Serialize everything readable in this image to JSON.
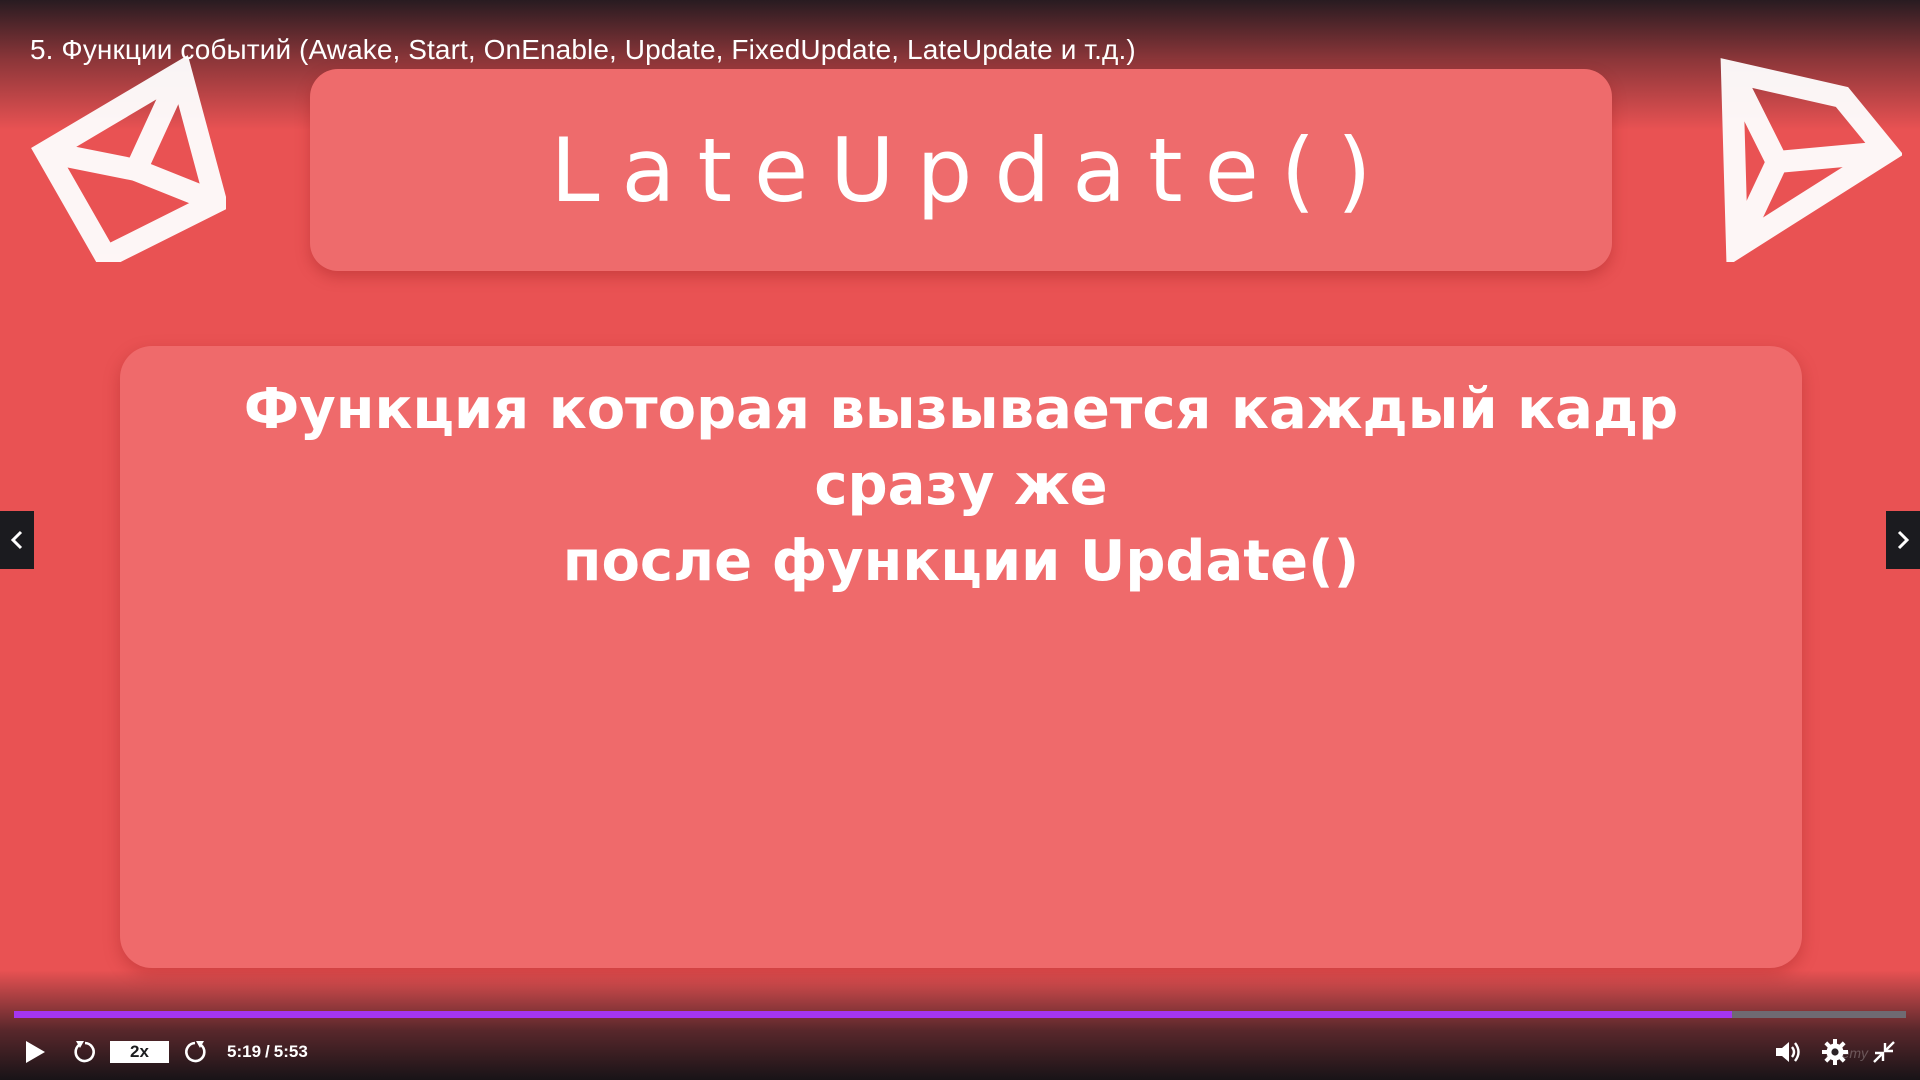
{
  "player": {
    "lecture_title": "5. Функции событий (Awake, Start, OnEnable, Update, FixedUpdate, LateUpdate и т.д.)",
    "progress_fraction": 0.908,
    "speed_label": "2x",
    "time_current": "5:19",
    "time_separator": "/",
    "time_total": "5:53",
    "accent_color": "#a435f0",
    "watermark": "udemy"
  },
  "slide": {
    "heading": "LateUpdate()",
    "body_line_1": "Функция которая вызывается каждый кадр сразу же",
    "body_line_2": "после функции Update()",
    "background_color": "#e95253",
    "card_color": "#ef6a6b",
    "logo_icon": "unity-logo-icon"
  },
  "icons": {
    "play": "play-icon",
    "rewind": "rewind-icon",
    "forward": "forward-icon",
    "volume": "volume-icon",
    "settings": "gear-icon",
    "fullscreen_exit": "exit-fullscreen-icon",
    "prev": "chevron-left-icon",
    "next": "chevron-right-icon"
  }
}
